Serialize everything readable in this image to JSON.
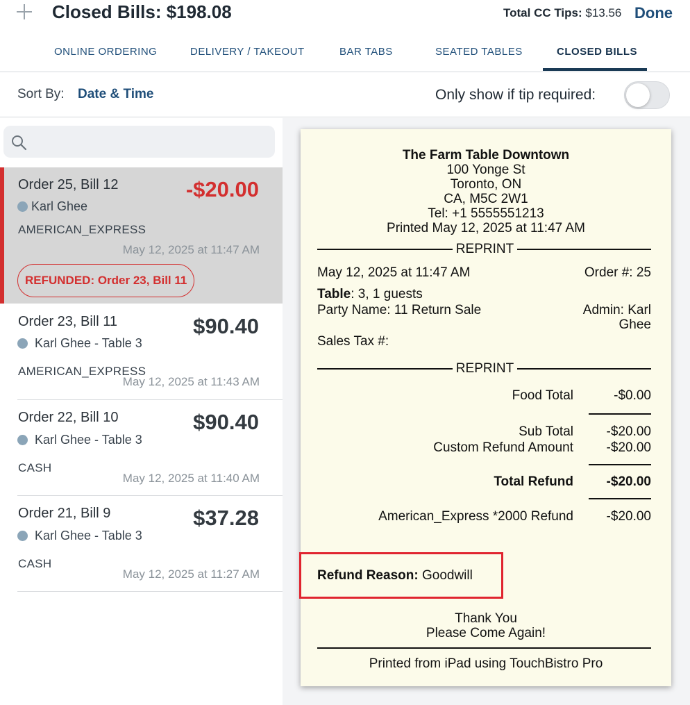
{
  "header": {
    "title": "Closed Bills: $198.08",
    "tips_label": "Total CC Tips:",
    "tips_value": "$13.56",
    "done_label": "Done"
  },
  "tabs": [
    {
      "label": "ONLINE ORDERING"
    },
    {
      "label": "DELIVERY / TAKEOUT"
    },
    {
      "label": "BAR TABS"
    },
    {
      "label": "SEATED TABLES"
    },
    {
      "label": "CLOSED BILLS"
    }
  ],
  "sortbar": {
    "sort_label": "Sort By:",
    "sort_value": "Date & Time",
    "tip_filter_label": "Only show if tip required:"
  },
  "search": {
    "placeholder": ""
  },
  "bills": [
    {
      "title": "Order 25, Bill 12",
      "amount": "-$20.00",
      "server": "Karl Ghee",
      "payment": "AMERICAN_EXPRESS",
      "date": "May 12, 2025 at 11:47 AM",
      "badge": "REFUNDED: Order 23, Bill 11"
    },
    {
      "title": "Order 23, Bill 11",
      "amount": "$90.40",
      "server": "Karl Ghee - Table 3",
      "payment": "AMERICAN_EXPRESS",
      "date": "May 12, 2025 at 11:43 AM"
    },
    {
      "title": "Order 22, Bill 10",
      "amount": "$90.40",
      "server": "Karl Ghee - Table 3",
      "payment": "CASH",
      "date": "May 12, 2025 at 11:40 AM"
    },
    {
      "title": "Order 21, Bill 9",
      "amount": "$37.28",
      "server": "Karl Ghee - Table 3",
      "payment": "CASH",
      "date": "May 12, 2025 at 11:27 AM"
    }
  ],
  "receipt": {
    "restaurant": "The Farm Table Downtown",
    "address1": "100 Yonge St",
    "address2": "Toronto, ON",
    "address3": "CA, M5C 2W1",
    "tel": "Tel: +1 5555551213",
    "printed": "Printed May 12, 2025 at 11:47 AM",
    "reprint": "REPRINT",
    "datetime": "May 12, 2025 at 11:47 AM",
    "order_no": "Order #: 25",
    "table_label": "Table",
    "table_value": ": 3, 1 guests",
    "party": "Party Name: 11 Return Sale",
    "admin1": "Admin: Karl",
    "admin2": "Ghee",
    "sales_tax": "Sales Tax #:",
    "food_total_label": "Food Total",
    "food_total_value": "-$0.00",
    "sub_total_label": "Sub Total",
    "sub_total_value": "-$20.00",
    "custom_refund_label": "Custom Refund Amount",
    "custom_refund_value": "-$20.00",
    "total_refund_label": "Total Refund",
    "total_refund_value": "-$20.00",
    "amex_label": "American_Express *2000 Refund",
    "amex_value": "-$20.00",
    "refund_reason_label": "Refund Reason:",
    "refund_reason_value": "Goodwill",
    "thank_you": "Thank You",
    "come_again": "Please Come Again!",
    "footer": "Printed from iPad using TouchBistro Pro"
  },
  "colors": {
    "accent_navy": "#1f4e79",
    "refund_red": "#d32f2f",
    "highlight_box": "#e0242f",
    "receipt_paper": "#fcfbea"
  },
  "icons": {
    "add": "plus-icon",
    "search": "search-icon",
    "status": "server-dot-icon"
  }
}
